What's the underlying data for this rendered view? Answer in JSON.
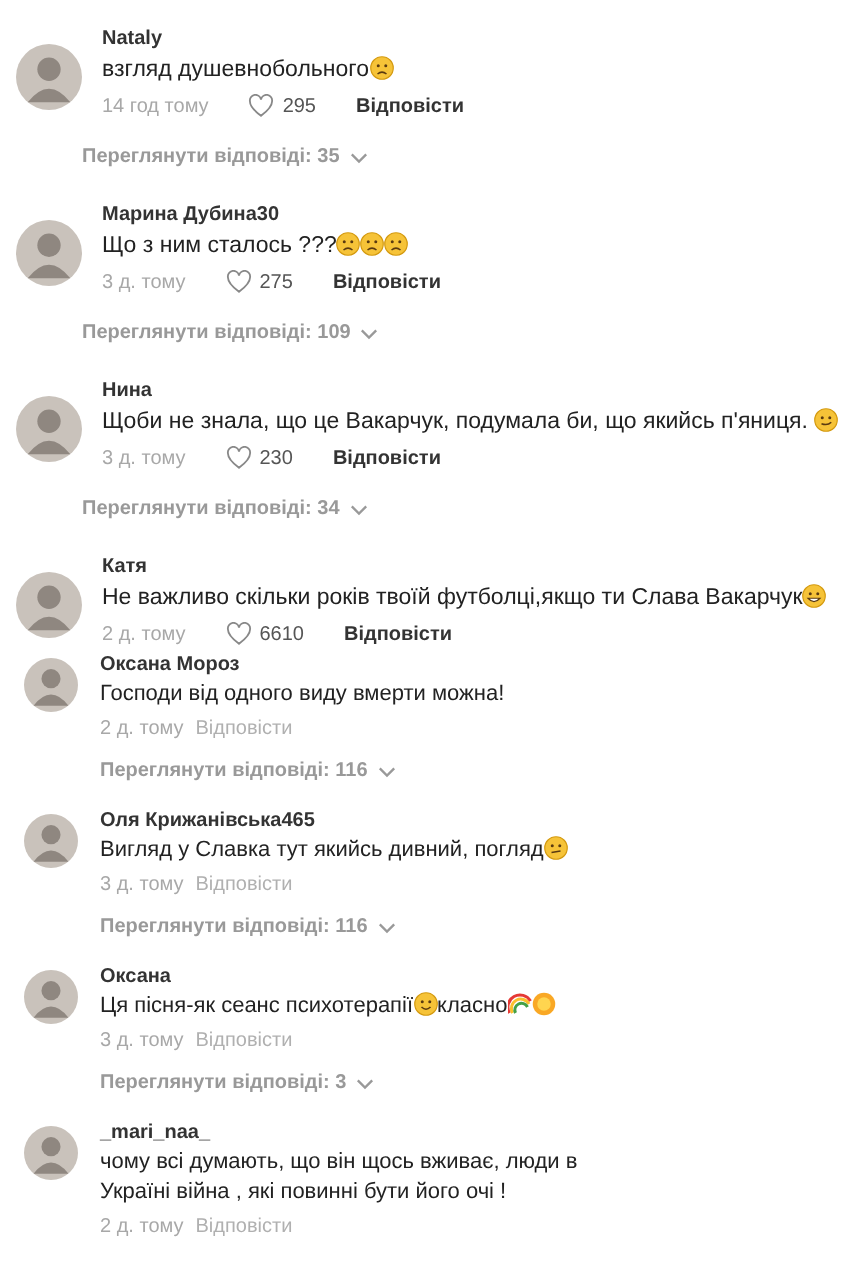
{
  "comments": [
    {
      "kind": "liked",
      "author": "Nataly",
      "parts": [
        {
          "kind": "text",
          "text": "взгляд душевнобольного"
        },
        {
          "kind": "frown"
        }
      ],
      "time": "14 год тому",
      "likes": "295",
      "reply": "Відповісти",
      "replies": "Переглянути відповіді: 35"
    },
    {
      "kind": "liked",
      "author": "Марина Дубина30",
      "parts": [
        {
          "kind": "text",
          "text": "Що з ним сталось ???"
        },
        {
          "kind": "frown"
        },
        {
          "kind": "frown"
        },
        {
          "kind": "frown"
        }
      ],
      "time": "3 д. тому",
      "likes": "275",
      "reply": "Відповісти",
      "replies": "Переглянути відповіді: 109"
    },
    {
      "kind": "liked",
      "author": "Нина",
      "parts": [
        {
          "kind": "text",
          "text": "Щоби не знала, що це Вакарчук, подумала би, що якийсь п'яниця. "
        },
        {
          "kind": "smirk"
        }
      ],
      "time": "3 д. тому",
      "likes": "230",
      "reply": "Відповісти",
      "replies": "Переглянути відповіді: 34"
    },
    {
      "kind": "liked",
      "author": "Катя",
      "parts": [
        {
          "kind": "text",
          "text": "Не важливо скільки років твоїй футболці,якщо ти Слава Вакарчук"
        },
        {
          "kind": "grin"
        }
      ],
      "time": "2 д. тому",
      "likes": "6610",
      "reply": "Відповісти"
    },
    {
      "kind": "plain",
      "author": "Оксана Мороз",
      "parts": [
        {
          "kind": "text",
          "text": "Господи від одного виду вмерти можна!"
        }
      ],
      "time": "2 д. тому",
      "reply": "Відповісти",
      "replies": "Переглянути відповіді: 116"
    },
    {
      "kind": "plain",
      "author": "Оля Крижанівська465",
      "parts": [
        {
          "kind": "text",
          "text": "Вигляд у Славка тут якийсь дивний, погляд"
        },
        {
          "kind": "confused"
        }
      ],
      "time": "3 д. тому",
      "reply": "Відповісти",
      "replies": "Переглянути відповіді: 116"
    },
    {
      "kind": "plain",
      "author": "Оксана",
      "parts": [
        {
          "kind": "text",
          "text": "Ця пісня-як сеанс психотерапії"
        },
        {
          "kind": "smile"
        },
        {
          "kind": "text",
          "text": "класно"
        },
        {
          "kind": "rainbow"
        },
        {
          "kind": "sun"
        }
      ],
      "time": "3 д. тому",
      "reply": "Відповісти",
      "replies": "Переглянути відповіді: 3"
    },
    {
      "kind": "plain",
      "author": "_mari_naa_",
      "parts": [
        {
          "kind": "text",
          "text": "чому всі думають, що він щось вживає, люди в Україні війна , які повинні бути його очі !"
        }
      ],
      "time": "2 д. тому",
      "reply": "Відповісти"
    }
  ]
}
